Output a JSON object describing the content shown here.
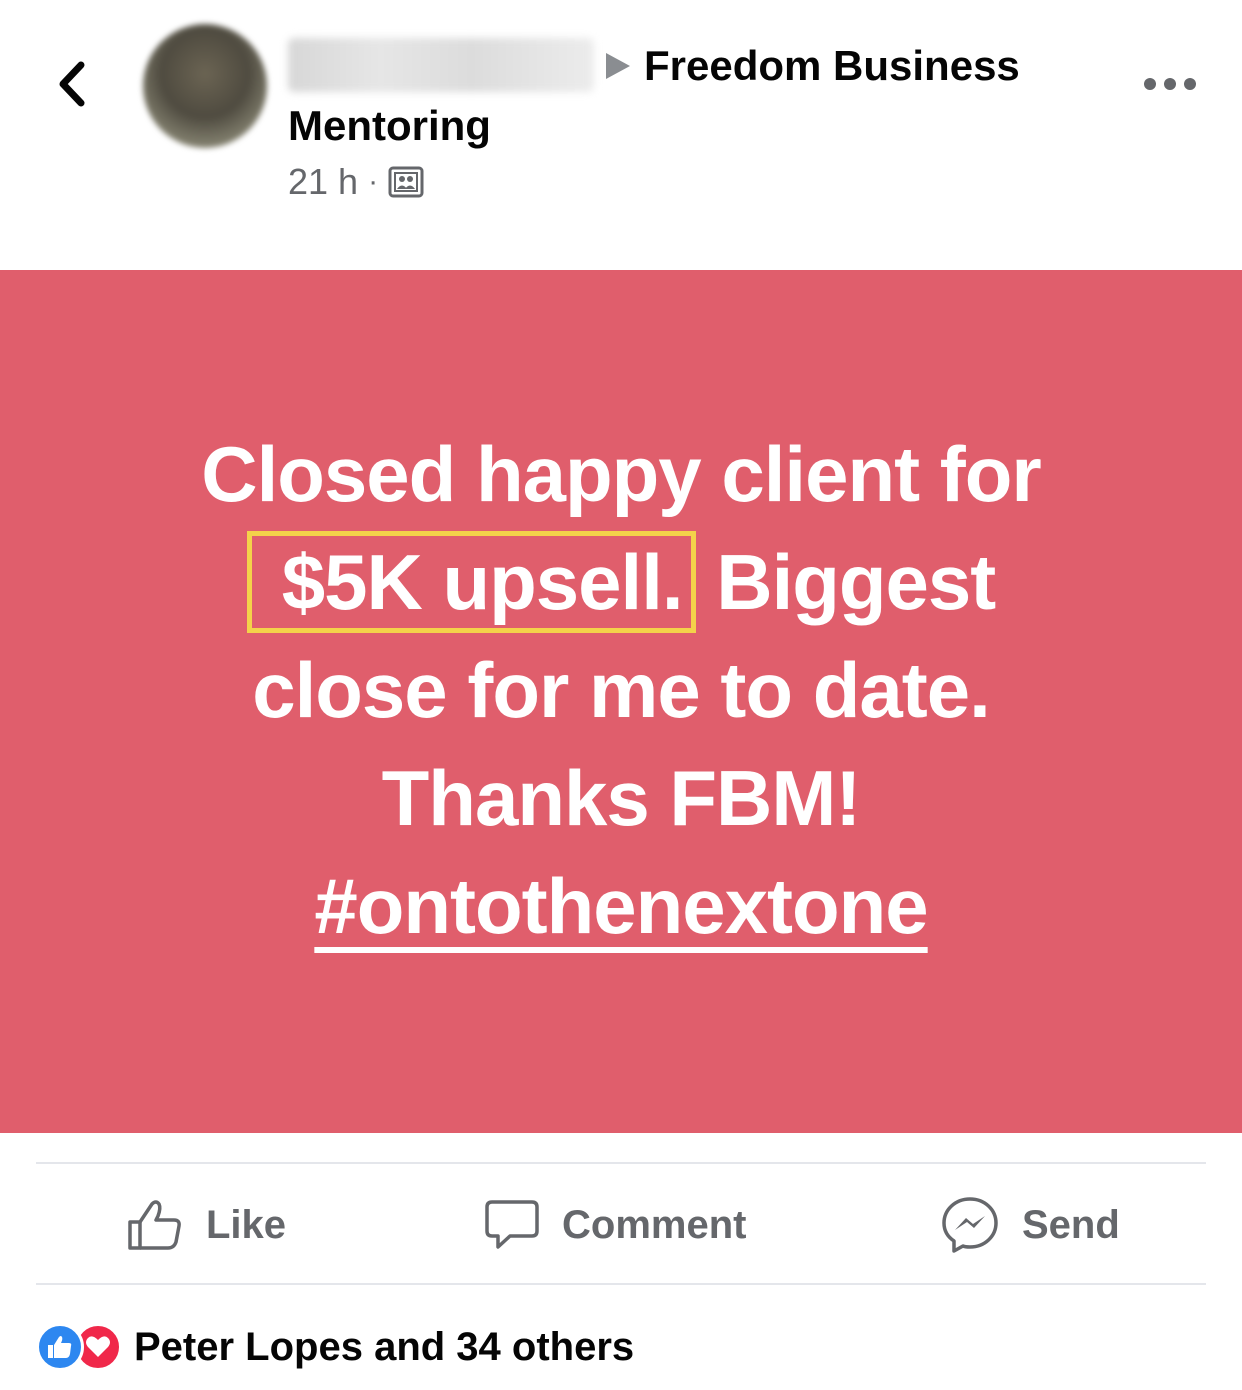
{
  "header": {
    "group_name_line1": "Freedom Business",
    "group_name_line2": "Mentoring",
    "timestamp": "21 h",
    "separator": "·"
  },
  "post": {
    "background_color": "#e05e6c",
    "line1": "Closed happy client for",
    "highlight": "$5K upsell.",
    "line2_rest": "Biggest",
    "line3": "close for me to date.",
    "line4": "Thanks FBM!",
    "hashtag": "#ontothenextone"
  },
  "actions": {
    "like_label": "Like",
    "comment_label": "Comment",
    "send_label": "Send"
  },
  "reactions": {
    "summary": "Peter Lopes and 34 others"
  },
  "icons": {
    "back": "chevron-left-icon",
    "more": "more-options-icon",
    "audience": "group-audience-icon",
    "like": "thumbs-up-icon",
    "comment": "comment-bubble-icon",
    "send": "messenger-icon"
  }
}
